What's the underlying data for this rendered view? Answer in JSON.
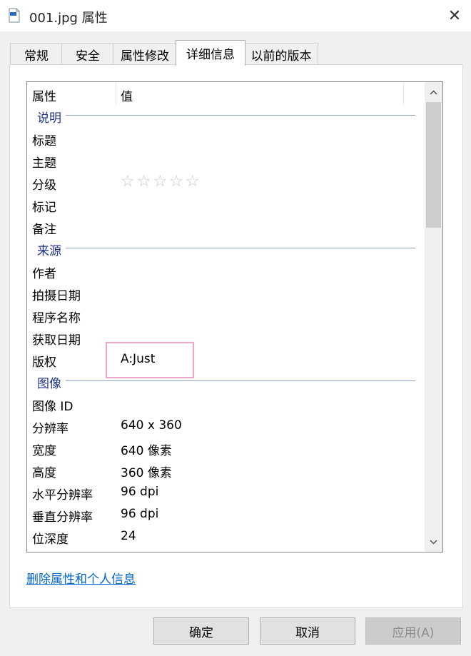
{
  "window": {
    "title": "001.jpg 属性",
    "close_glyph": "✕"
  },
  "tabs": [
    {
      "label": "常规"
    },
    {
      "label": "安全"
    },
    {
      "label": "属性修改"
    },
    {
      "label": "详细信息",
      "active": true
    },
    {
      "label": "以前的版本"
    }
  ],
  "list": {
    "header": {
      "property": "属性",
      "value": "值"
    },
    "groups": {
      "description": {
        "label": "说明",
        "rows": {
          "title": {
            "name": "标题",
            "value": ""
          },
          "subject": {
            "name": "主题",
            "value": ""
          },
          "rating": {
            "name": "分级",
            "stars": "☆☆☆☆☆"
          },
          "tags": {
            "name": "标记",
            "value": ""
          },
          "comments": {
            "name": "备注",
            "value": ""
          }
        }
      },
      "origin": {
        "label": "来源",
        "rows": {
          "author": {
            "name": "作者",
            "value": ""
          },
          "date_taken": {
            "name": "拍摄日期",
            "value": ""
          },
          "program": {
            "name": "程序名称",
            "value": ""
          },
          "date_acquired": {
            "name": "获取日期",
            "value": ""
          },
          "copyright": {
            "name": "版权",
            "value": "A:Just"
          }
        }
      },
      "image": {
        "label": "图像",
        "rows": {
          "image_id": {
            "name": "图像 ID",
            "value": ""
          },
          "dimensions": {
            "name": "分辨率",
            "value": "640 x 360"
          },
          "width": {
            "name": "宽度",
            "value": "640 像素"
          },
          "height": {
            "name": "高度",
            "value": "360 像素"
          },
          "h_res": {
            "name": "水平分辨率",
            "value": "96 dpi"
          },
          "v_res": {
            "name": "垂直分辨率",
            "value": "96 dpi"
          },
          "bit_depth": {
            "name": "位深度",
            "value": "24"
          }
        }
      }
    }
  },
  "remove_link": "删除属性和个人信息",
  "buttons": {
    "ok": "确定",
    "cancel": "取消",
    "apply": "应用(A)"
  },
  "colors": {
    "group_label": "#1e3287",
    "link": "#0066cc",
    "highlight_border": "#f0a6c8"
  }
}
